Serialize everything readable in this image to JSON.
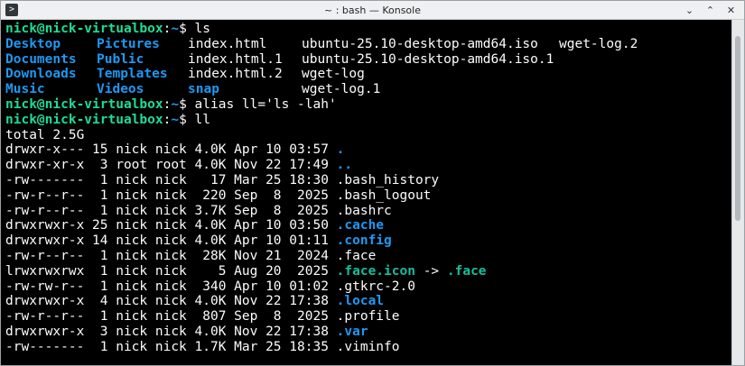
{
  "window": {
    "title": "~ : bash — Konsole",
    "app_icon": ">",
    "minimize": "⌄",
    "maximize": "⌃",
    "close": "✕"
  },
  "colors": {
    "user_prompt": "#1cdc9a",
    "directory": "#1d99f3",
    "symlink": "#1abc9c",
    "text": "#fcfcfc"
  },
  "prompt": {
    "userhost": "nick@nick-virtualbox",
    "sep": ":",
    "path": "~",
    "symbol": "$ "
  },
  "commands": [
    "ls",
    "alias ll='ls -lah'",
    "ll"
  ],
  "ls_rows": [
    [
      {
        "t": "Desktop",
        "c": "dir"
      },
      {
        "t": "Pictures",
        "c": "dir"
      },
      {
        "t": "index.html",
        "c": "norm"
      },
      {
        "t": "ubuntu-25.10-desktop-amd64.iso",
        "c": "norm"
      },
      {
        "t": "wget-log.2",
        "c": "norm"
      }
    ],
    [
      {
        "t": "Documents",
        "c": "dir"
      },
      {
        "t": "Public",
        "c": "dir"
      },
      {
        "t": "index.html.1",
        "c": "norm"
      },
      {
        "t": "ubuntu-25.10-desktop-amd64.iso.1",
        "c": "norm"
      },
      {
        "t": "",
        "c": "norm"
      }
    ],
    [
      {
        "t": "Downloads",
        "c": "dir"
      },
      {
        "t": "Templates",
        "c": "dir"
      },
      {
        "t": "index.html.2",
        "c": "norm"
      },
      {
        "t": "wget-log",
        "c": "norm"
      },
      {
        "t": "",
        "c": "norm"
      }
    ],
    [
      {
        "t": "Music",
        "c": "dir"
      },
      {
        "t": "Videos",
        "c": "dir"
      },
      {
        "t": "snap",
        "c": "dir"
      },
      {
        "t": "wget-log.1",
        "c": "norm"
      },
      {
        "t": "",
        "c": "norm"
      }
    ]
  ],
  "total_line": "total 2.5G",
  "ll_entries": [
    {
      "meta": "drwxr-x--- 15 nick nick 4.0K Apr 10 03:57 ",
      "name": ".",
      "cls": "dir"
    },
    {
      "meta": "drwxr-xr-x  3 root root 4.0K Nov 22 17:49 ",
      "name": "..",
      "cls": "dir"
    },
    {
      "meta": "-rw-------  1 nick nick   17 Mar 25 18:30 ",
      "name": ".bash_history",
      "cls": "norm"
    },
    {
      "meta": "-rw-r--r--  1 nick nick  220 Sep  8  2025 ",
      "name": ".bash_logout",
      "cls": "norm"
    },
    {
      "meta": "-rw-r--r--  1 nick nick 3.7K Sep  8  2025 ",
      "name": ".bashrc",
      "cls": "norm"
    },
    {
      "meta": "drwxrwxr-x 25 nick nick 4.0K Apr 10 03:50 ",
      "name": ".cache",
      "cls": "dir"
    },
    {
      "meta": "drwxrwxr-x 14 nick nick 4.0K Apr 10 01:11 ",
      "name": ".config",
      "cls": "dir"
    },
    {
      "meta": "-rw-r--r--  1 nick nick  28K Nov 21  2024 ",
      "name": ".face",
      "cls": "norm"
    },
    {
      "meta": "lrwxrwxrwx  1 nick nick    5 Aug 20  2025 ",
      "name": ".face.icon",
      "cls": "lnk",
      "arrow": " -> ",
      "target": ".face"
    },
    {
      "meta": "-rw-rw-r--  1 nick nick  340 Apr 10 01:02 ",
      "name": ".gtkrc-2.0",
      "cls": "norm"
    },
    {
      "meta": "drwxrwxr-x  4 nick nick 4.0K Nov 22 17:38 ",
      "name": ".local",
      "cls": "dir"
    },
    {
      "meta": "-rw-r--r--  1 nick nick  807 Sep  8  2025 ",
      "name": ".profile",
      "cls": "norm"
    },
    {
      "meta": "drwxrwxr-x  3 nick nick 4.0K Nov 22 17:38 ",
      "name": ".var",
      "cls": "dir"
    },
    {
      "meta": "-rw-------  1 nick nick 1.7K Mar 25 18:35 ",
      "name": ".viminfo",
      "cls": "norm"
    }
  ]
}
